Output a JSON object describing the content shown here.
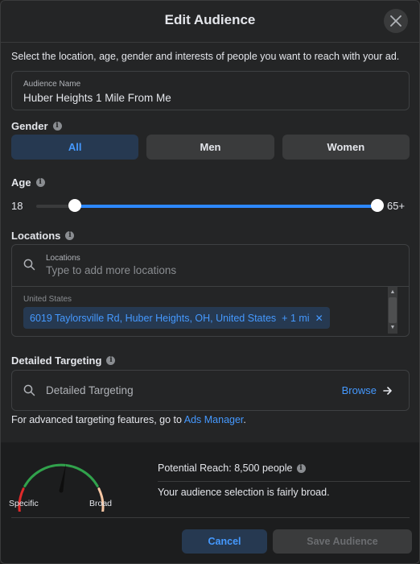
{
  "dialog": {
    "title": "Edit Audience",
    "intro": "Select the location, age, gender and interests of people you want to reach with your ad."
  },
  "audience_name": {
    "label": "Audience Name",
    "value": "Huber Heights 1 Mile From Me"
  },
  "gender": {
    "label": "Gender",
    "options": [
      "All",
      "Men",
      "Women"
    ],
    "selected": "All"
  },
  "age": {
    "label": "Age",
    "min_label": "18",
    "max_label": "65+",
    "min": 18,
    "max": 65
  },
  "locations": {
    "label": "Locations",
    "field_label": "Locations",
    "placeholder": "Type to add more locations",
    "country": "United States",
    "chip": "6019 Taylorsville Rd, Huber Heights, OH, United States",
    "radius": "+ 1 mi"
  },
  "detailed_targeting": {
    "label": "Detailed Targeting",
    "placeholder": "Detailed Targeting",
    "browse": "Browse"
  },
  "advanced": {
    "prefix": "For advanced targeting features, go to",
    "link": "Ads Manager",
    "suffix": "."
  },
  "gauge": {
    "specific_label": "Specific",
    "broad_label": "Broad",
    "level": 0.55
  },
  "reach": {
    "text": "Potential Reach: 8,500 people",
    "description": "Your audience selection is fairly broad."
  },
  "buttons": {
    "cancel": "Cancel",
    "save": "Save Audience"
  },
  "colors": {
    "accent": "#2d88ff",
    "accent_text": "#4599ff",
    "gauge_red": "#e02a2a",
    "gauge_green": "#31a24c",
    "gauge_tan": "#f7c6a3"
  }
}
